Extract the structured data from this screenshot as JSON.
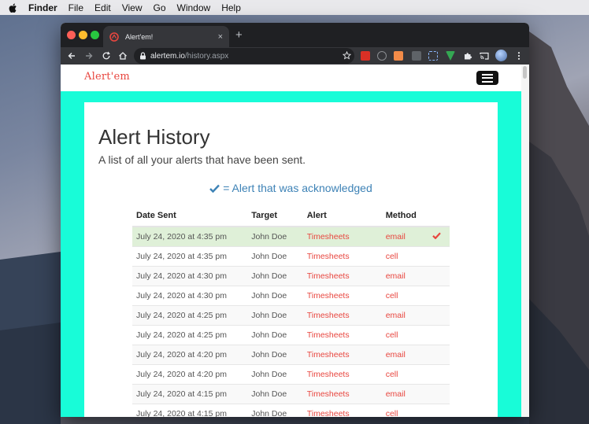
{
  "menubar": {
    "items": [
      "Finder",
      "File",
      "Edit",
      "View",
      "Go",
      "Window",
      "Help"
    ]
  },
  "browser": {
    "tab_title": "Alert'em!",
    "tab_close": "×",
    "new_tab": "+",
    "url_host": "alertem.io",
    "url_path": "/history.aspx"
  },
  "site": {
    "logo": "Alert'em",
    "accent_color": "#e8463f",
    "background_color": "#18fcd8"
  },
  "page": {
    "title": "Alert History",
    "subtitle": "A list of all your alerts that have been sent.",
    "legend_text": "= Alert that was acknowledged"
  },
  "table": {
    "headers": [
      "Date Sent",
      "Target",
      "Alert",
      "Method"
    ],
    "rows": [
      {
        "date": "July 24, 2020 at 4:35 pm",
        "target": "John Doe",
        "alert": "Timesheets",
        "method": "email",
        "acknowledged": true
      },
      {
        "date": "July 24, 2020 at 4:35 pm",
        "target": "John Doe",
        "alert": "Timesheets",
        "method": "cell",
        "acknowledged": false
      },
      {
        "date": "July 24, 2020 at 4:30 pm",
        "target": "John Doe",
        "alert": "Timesheets",
        "method": "email",
        "acknowledged": false
      },
      {
        "date": "July 24, 2020 at 4:30 pm",
        "target": "John Doe",
        "alert": "Timesheets",
        "method": "cell",
        "acknowledged": false
      },
      {
        "date": "July 24, 2020 at 4:25 pm",
        "target": "John Doe",
        "alert": "Timesheets",
        "method": "email",
        "acknowledged": false
      },
      {
        "date": "July 24, 2020 at 4:25 pm",
        "target": "John Doe",
        "alert": "Timesheets",
        "method": "cell",
        "acknowledged": false
      },
      {
        "date": "July 24, 2020 at 4:20 pm",
        "target": "John Doe",
        "alert": "Timesheets",
        "method": "email",
        "acknowledged": false
      },
      {
        "date": "July 24, 2020 at 4:20 pm",
        "target": "John Doe",
        "alert": "Timesheets",
        "method": "cell",
        "acknowledged": false
      },
      {
        "date": "July 24, 2020 at 4:15 pm",
        "target": "John Doe",
        "alert": "Timesheets",
        "method": "email",
        "acknowledged": false
      },
      {
        "date": "July 24, 2020 at 4:15 pm",
        "target": "John Doe",
        "alert": "Timesheets",
        "method": "cell",
        "acknowledged": false
      }
    ]
  }
}
